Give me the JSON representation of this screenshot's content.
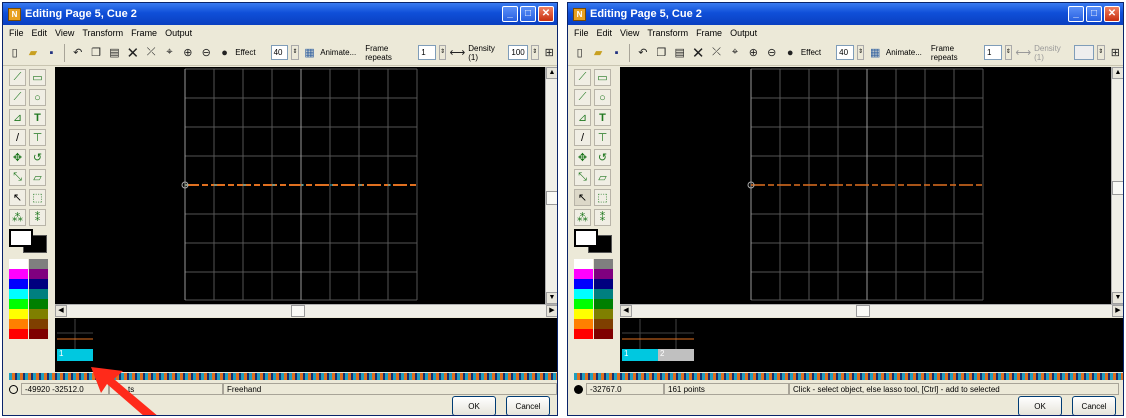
{
  "window_title": "Editing Page 5, Cue 2",
  "app_icon_text": "N",
  "menu": [
    "File",
    "Edit",
    "View",
    "Transform",
    "Frame",
    "Output"
  ],
  "toolbar": {
    "effect_label": "Effect",
    "effect_value": "40",
    "animate_label": "Animate...",
    "frame_repeats_label": "Frame repeats",
    "frame_repeats_value": "1",
    "density_label": "Density (1)",
    "density_value": "100"
  },
  "left": {
    "status_coords": "-49920 -32512.0",
    "status_points": "ts",
    "status_tool": "Freehand",
    "frame_number": "1"
  },
  "right": {
    "status_coords": "-32767.0",
    "status_points": "161 points",
    "status_hint": "Click - select object, else lasso tool, [Ctrl] - add to selected",
    "frame_number_1": "1",
    "frame_number_2": "2"
  },
  "buttons": {
    "ok": "OK",
    "cancel": "Cancel"
  },
  "palette": [
    "#ffffff",
    "#7f7f7f",
    "#ff00ff",
    "#7f007f",
    "#0000ff",
    "#00007f",
    "#00ffff",
    "#007f7f",
    "#00ff00",
    "#007f00",
    "#ffff00",
    "#7f7f00",
    "#ff7f00",
    "#7f3f00",
    "#ff0000",
    "#7f0000"
  ],
  "accent_colors": {
    "titlebar": "#0f4fd8",
    "laser_line": "#e07020",
    "frame_thumb": "#00c8e0",
    "arrow": "#ff2a1a"
  }
}
